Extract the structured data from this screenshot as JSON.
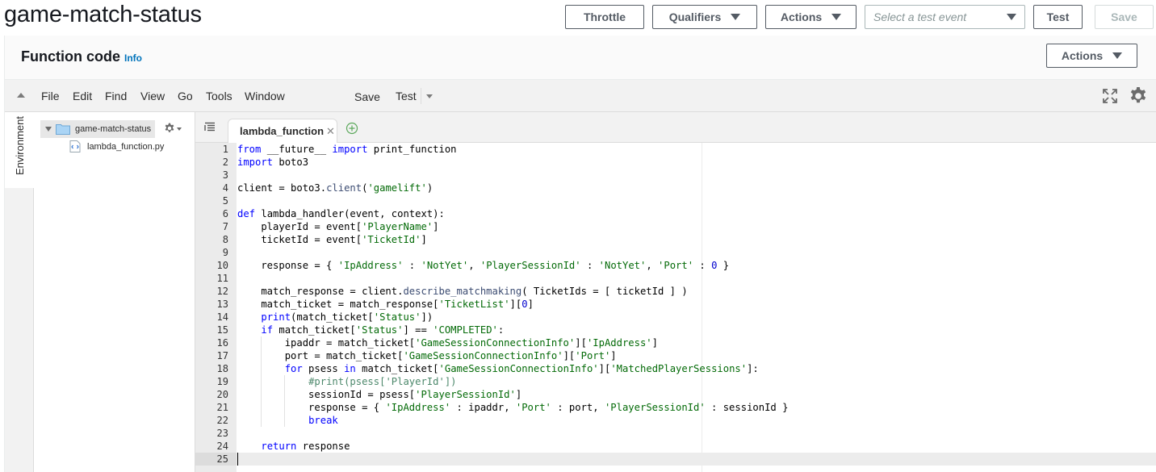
{
  "header": {
    "function_name": "game-match-status",
    "throttle_label": "Throttle",
    "qualifiers_label": "Qualifiers",
    "actions_label": "Actions",
    "test_event_placeholder": "Select a test event",
    "test_label": "Test",
    "save_label": "Save"
  },
  "panel": {
    "title": "Function code",
    "info_label": "Info",
    "actions_label": "Actions"
  },
  "ide": {
    "menu": [
      "File",
      "Edit",
      "Find",
      "View",
      "Go",
      "Tools",
      "Window"
    ],
    "save_label": "Save",
    "test_label": "Test",
    "environment_label": "Environment",
    "tree": {
      "root": "game-match-status",
      "file": "lambda_function.py"
    },
    "tab_label": "lambda_function",
    "lines": [
      "from __future__ import print_function",
      "import boto3",
      "",
      "client = boto3.client('gamelift')",
      "",
      "def lambda_handler(event, context):",
      "    playerId = event['PlayerName']",
      "    ticketId = event['TicketId']",
      "",
      "    response = { 'IpAddress' : 'NotYet', 'PlayerSessionId' : 'NotYet', 'Port' : 0 }",
      "",
      "    match_response = client.describe_matchmaking( TicketIds = [ ticketId ] )",
      "    match_ticket = match_response['TicketList'][0]",
      "    print(match_ticket['Status'])",
      "    if match_ticket['Status'] == 'COMPLETED':",
      "        ipaddr = match_ticket['GameSessionConnectionInfo']['IpAddress']",
      "        port = match_ticket['GameSessionConnectionInfo']['Port']",
      "        for psess in match_ticket['GameSessionConnectionInfo']['MatchedPlayerSessions']:",
      "            #print(psess['PlayerId'])",
      "            sessionId = psess['PlayerSessionId']",
      "            response = { 'IpAddress' : ipaddr, 'Port' : port, 'PlayerSessionId' : sessionId }",
      "            break",
      "",
      "    return response",
      ""
    ]
  },
  "colors": {
    "keyword": "#0000ff",
    "string": "#036a07",
    "number": "#0000cd",
    "comment": "#4c886b",
    "link": "#0073bb"
  }
}
